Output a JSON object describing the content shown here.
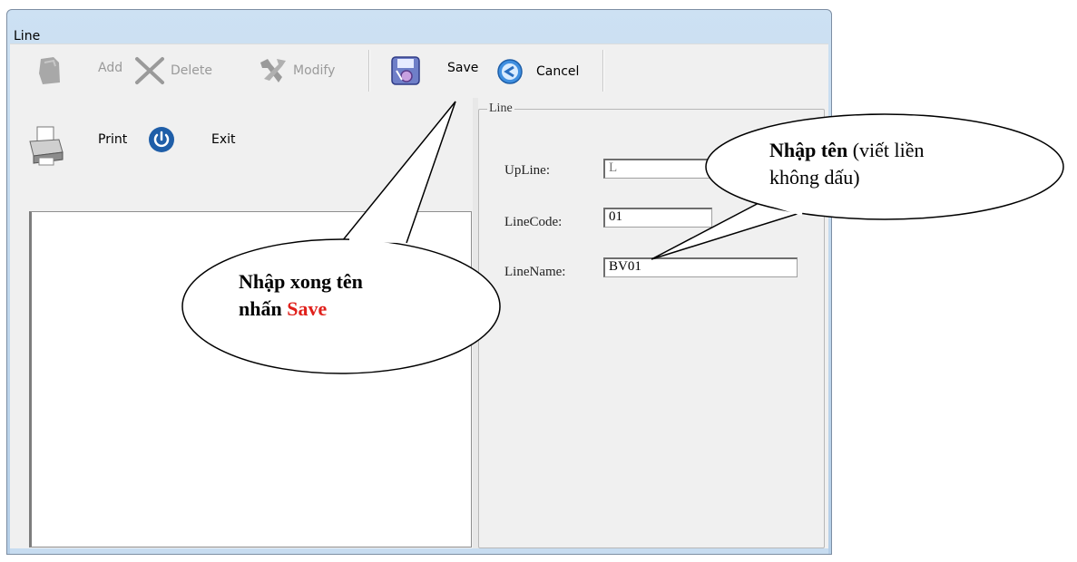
{
  "window": {
    "title": "Line"
  },
  "toolbar": {
    "add_label": "Add",
    "delete_label": "Delete",
    "modify_label": "Modify",
    "save_label": "Save",
    "cancel_label": "Cancel",
    "print_label": "Print",
    "exit_label": "Exit"
  },
  "form": {
    "group_title": "Line",
    "upline_label": "UpLine:",
    "upline_value": "L",
    "linecode_label": "LineCode:",
    "linecode_value": "01",
    "linename_label": "LineName:",
    "linename_value": "BV01"
  },
  "callouts": {
    "save_note_line1": "Nhập xong tên",
    "save_note_prefix": "nhấn",
    "save_note_action": "Save",
    "name_note_bold": "Nhập tên",
    "name_note_rest": "(viết liền",
    "name_note_line2": "không dấu)"
  },
  "colors": {
    "accent_red": "#e0201b",
    "title_bar": "#cde1f3"
  }
}
